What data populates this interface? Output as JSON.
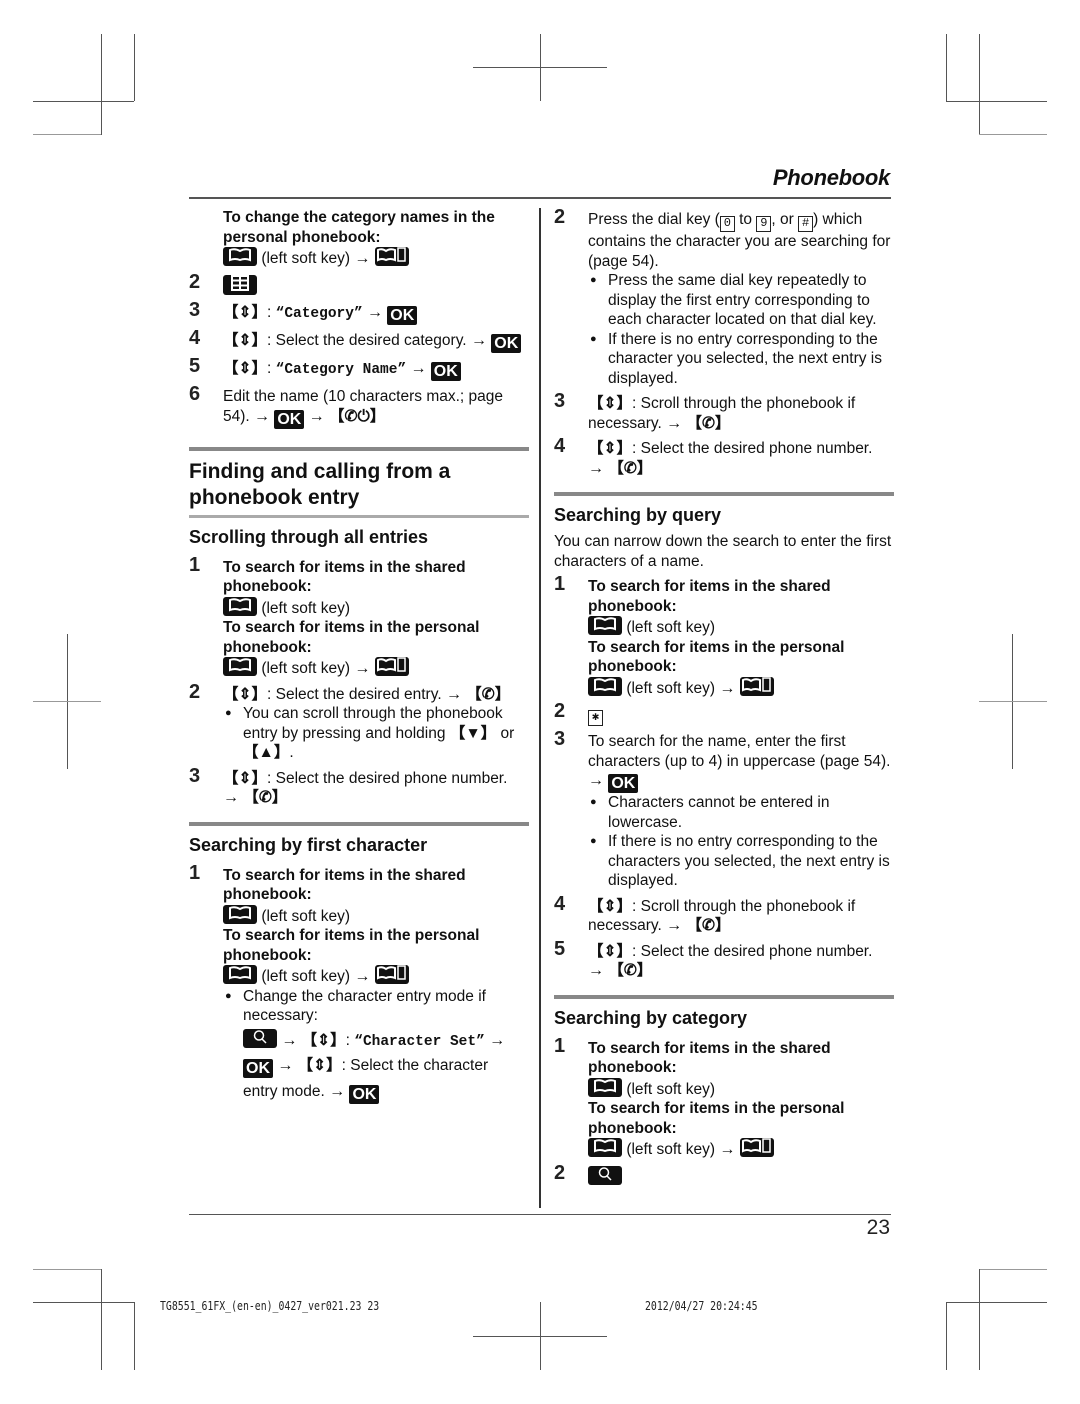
{
  "header": {
    "title": "Phonebook"
  },
  "footer": {
    "page_number": "23",
    "slug_left": "TG8551_61FX_(en-en)_0427_ver021.23   23",
    "slug_right": "2012/04/27   20:24:45"
  },
  "common": {
    "shared_label": "To search for items in the shared phonebook:",
    "personal_label": "To search for items in the personal phonebook:",
    "left_soft_key": "(left soft key)",
    "arrow": "→",
    "ok": "OK",
    "open_bracket": "【",
    "close_bracket": "】",
    "colon": ":"
  },
  "left": {
    "category_names": {
      "intro": "To change the category names in the personal phonebook:",
      "steps": [
        {
          "num": "2"
        },
        {
          "num": "3",
          "quote": "“Category”"
        },
        {
          "num": "4",
          "text": "Select the desired category."
        },
        {
          "num": "5",
          "quote": "“Category Name”"
        },
        {
          "num": "6",
          "text": "Edit the name (10 characters max.; page 54)."
        }
      ]
    },
    "finding_title": "Finding and calling from a phonebook entry",
    "scrolling": {
      "title": "Scrolling through all entries",
      "step1_num": "1",
      "step2_num": "2",
      "step2_text": "Select the desired entry.",
      "step2_bullet": "You can scroll through the phonebook entry by pressing and holding",
      "step2_bullet_or": "or",
      "down_key": "▼",
      "up_key": "▲",
      "step3_num": "3",
      "step3_text": "Select the desired phone number."
    },
    "first_char": {
      "title": "Searching by first character",
      "step1_num": "1",
      "bullet": "Change the character entry mode if necessary:",
      "char_set": "“Character Set”",
      "select_mode": "Select the character",
      "entry_mode": "entry mode."
    }
  },
  "right": {
    "first_char_cont": {
      "step2_num": "2",
      "step2_text_a": "Press the dial key (",
      "dial_0": "0",
      "to": "to",
      "dial_9": "9",
      "or": ", or",
      "dial_hash": "#",
      "step2_text_b": ") which contains the character you are searching for (page 54).",
      "bullets": [
        "Press the same dial key repeatedly to display the first entry corresponding to each character located on that dial key.",
        "If there is no entry corresponding to the character you selected, the next entry is displayed."
      ],
      "step3_num": "3",
      "step3_text": "Scroll through the phonebook if necessary.",
      "step4_num": "4",
      "step4_text": "Select the desired phone number."
    },
    "query": {
      "title": "Searching by query",
      "intro": "You can narrow down the search to enter the first characters of a name.",
      "step1_num": "1",
      "step2_num": "2",
      "star_key": "✱",
      "step3_num": "3",
      "step3_text": "To search for the name, enter the first characters (up to 4) in uppercase (page 54).",
      "bullets": [
        "Characters cannot be entered in lowercase.",
        "If there is no entry corresponding to the characters you selected, the next entry is displayed."
      ],
      "step4_num": "4",
      "step4_text": "Scroll through the phonebook if necessary.",
      "step5_num": "5",
      "step5_text": "Select the desired phone number."
    },
    "category": {
      "title": "Searching by category",
      "step1_num": "1",
      "step2_num": "2"
    }
  }
}
